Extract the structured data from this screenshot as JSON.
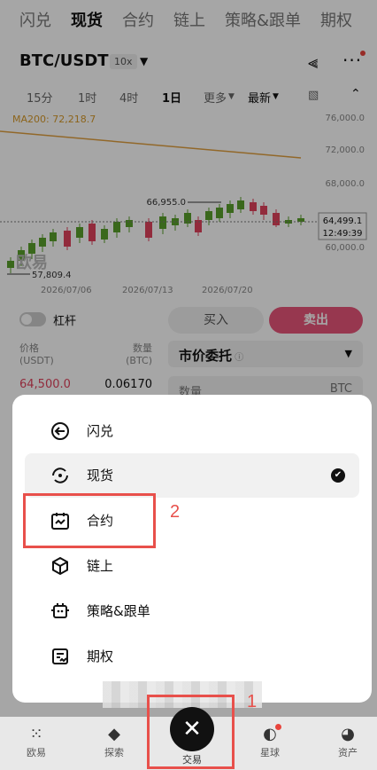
{
  "top_tabs": [
    "闪兑",
    "现货",
    "合约",
    "链上",
    "策略&跟单",
    "期权"
  ],
  "pair": {
    "name": "BTC/USDT",
    "leverage": "10x"
  },
  "timeframes": [
    "15分",
    "1时",
    "4时",
    "1日",
    "更多",
    "最新"
  ],
  "chart": {
    "ma_label": "MA200: 72,218.7",
    "y_ticks": [
      "76,000.0",
      "72,000.0",
      "68,000.0",
      "64,000.0",
      "60,000.0"
    ],
    "x_ticks": [
      "2026/07/06",
      "2026/07/13",
      "2026/07/20"
    ],
    "high_label": "66,955.0",
    "low_label": "57,809.4",
    "last_price": "64,499.1",
    "countdown": "12:49:39",
    "watermark": "欧易"
  },
  "trade": {
    "lever_label": "杠杆",
    "buy_label": "买入",
    "sell_label": "卖出",
    "price_head": "价格\n(USDT)",
    "qty_head": "数量\n(BTC)",
    "price_head_a": "价格",
    "price_head_b": "(USDT)",
    "qty_head_a": "数量",
    "qty_head_b": "(BTC)",
    "ob_price": "64,500.0",
    "ob_qty": "0.06170",
    "order_type": "市价委托",
    "qty_label": "数量",
    "qty_unit": "BTC"
  },
  "menu": {
    "items": [
      {
        "label": "闪兑",
        "icon": "swap-circle-icon"
      },
      {
        "label": "现货",
        "icon": "refresh-circle-icon",
        "selected": true
      },
      {
        "label": "合约",
        "icon": "contract-calendar-icon"
      },
      {
        "label": "链上",
        "icon": "cube-icon"
      },
      {
        "label": "策略&跟单",
        "icon": "bot-icon"
      },
      {
        "label": "期权",
        "icon": "options-doc-icon"
      }
    ]
  },
  "bottom_nav": {
    "items": [
      "欧易",
      "探索",
      "交易",
      "星球",
      "资产"
    ]
  },
  "annotations": {
    "one": "1",
    "two": "2"
  },
  "colors": {
    "sell": "#e8557a",
    "annotation": "#e8504b",
    "up": "#5aa02c",
    "down": "#e0435d"
  }
}
